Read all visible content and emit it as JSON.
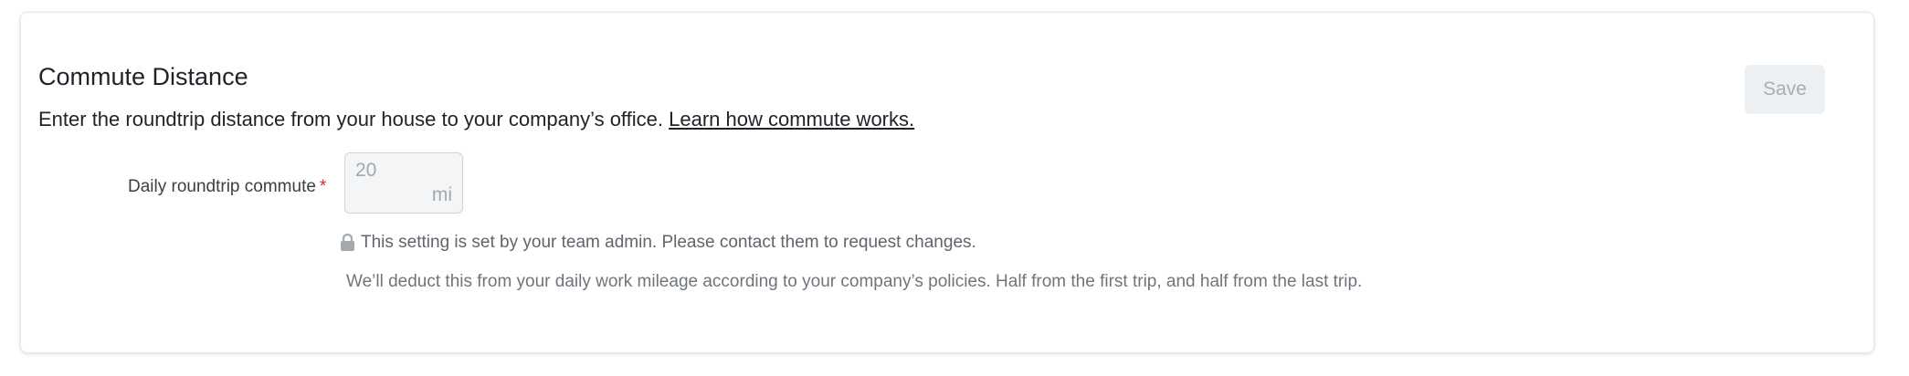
{
  "section": {
    "title": "Commute Distance",
    "description": "Enter the roundtrip distance from your house to your company’s office.",
    "link_label": "Learn how commute works."
  },
  "toolbar": {
    "save_label": "Save"
  },
  "field": {
    "label": "Daily roundtrip commute",
    "required_marker": "*",
    "value": "20",
    "unit": "mi"
  },
  "notice": {
    "icon": "lock-icon",
    "text": "This setting is set by your team admin. Please contact them to request changes."
  },
  "help": {
    "text": "We’ll deduct this from your daily work mileage according to your company’s policies. Half from the first trip, and half from the last trip."
  },
  "colors": {
    "required": "#d0303a",
    "save_bg_disabled": "#edf0f3",
    "save_text_disabled": "#a7adb4"
  }
}
